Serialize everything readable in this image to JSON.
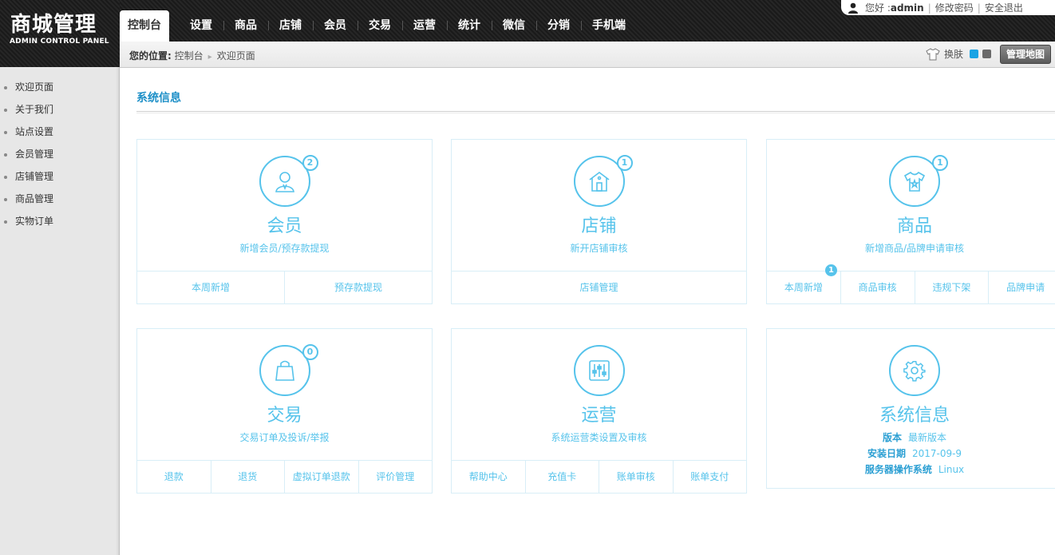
{
  "logo": {
    "title": "商城管理",
    "subtitle": "ADMIN CONTROL PANEL"
  },
  "nav": [
    "控制台",
    "设置",
    "商品",
    "店铺",
    "会员",
    "交易",
    "运营",
    "统计",
    "微信",
    "分销",
    "手机端"
  ],
  "user": {
    "greeting": "您好 : ",
    "name": "admin",
    "change_password": "修改密码",
    "logout": "安全退出"
  },
  "breadcrumb": {
    "label": "您的位置:",
    "items": [
      "控制台",
      "欢迎页面"
    ]
  },
  "skin": {
    "label": "换肤",
    "colors": [
      "#1aa3e4",
      "#6a6a6a"
    ]
  },
  "map_button": "管理地图",
  "sidebar": [
    "欢迎页面",
    "关于我们",
    "站点设置",
    "会员管理",
    "店铺管理",
    "商品管理",
    "实物订单"
  ],
  "section_title": "系统信息",
  "cards": {
    "member": {
      "name": "会员",
      "desc": "新增会员/预存款提现",
      "badge": "2",
      "icon": "user-icon",
      "links": [
        "本周新增",
        "预存款提现"
      ]
    },
    "store": {
      "name": "店铺",
      "desc": "新开店铺审核",
      "badge": "1",
      "icon": "store-icon",
      "links": [
        "店铺管理"
      ]
    },
    "goods": {
      "name": "商品",
      "desc": "新增商品/品牌申请审核",
      "badge": "1",
      "icon": "shirt-icon",
      "links": [
        "本周新增",
        "商品审核",
        "违规下架",
        "品牌申请"
      ],
      "link_badge": "1"
    },
    "trade": {
      "name": "交易",
      "desc": "交易订单及投诉/举报",
      "badge": "0",
      "icon": "bag-icon",
      "links": [
        "退款",
        "退货",
        "虚拟订单退款",
        "评价管理"
      ]
    },
    "ops": {
      "name": "运营",
      "desc": "系统运营类设置及审核",
      "icon": "sliders-icon",
      "links": [
        "帮助中心",
        "充值卡",
        "账单审核",
        "账单支付"
      ]
    },
    "system": {
      "name": "系统信息",
      "icon": "gear-icon",
      "rows": [
        {
          "label": "版本",
          "value": "最新版本"
        },
        {
          "label": "安装日期",
          "value": "2017-09-9"
        },
        {
          "label": "服务器操作系统",
          "value": "Linux"
        }
      ]
    }
  },
  "accent_color": "#56c3eb"
}
